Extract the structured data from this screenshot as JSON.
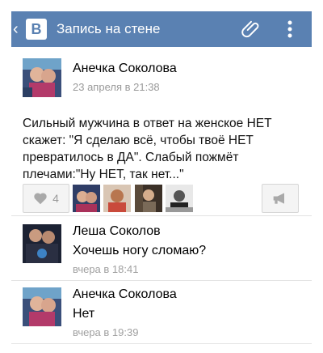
{
  "app": {
    "logo_letter": "В",
    "title": "Запись на стене",
    "accent_color": "#5a81b2",
    "icons": [
      "chevron-left-icon",
      "paperclip-icon",
      "more-vertical-icon"
    ]
  },
  "post": {
    "author": "Анечка Соколова",
    "date": "23 апреля в 21:38",
    "text": "Сильный мужчина в ответ на женское НЕТ скажет: \"Я сделаю всё, чтобы твоё НЕТ превратилось в ДА\". Слабый пожмёт плечами:\"Ну НЕТ, так нет...\"",
    "likes_count": "4"
  },
  "comments": [
    {
      "author": "Леша Соколов",
      "text": "Хочешь ногу сломаю?",
      "time": "вчера в 18:41"
    },
    {
      "author": "Анечка Соколова",
      "text": "Нет",
      "time": "вчера в 19:39"
    }
  ]
}
